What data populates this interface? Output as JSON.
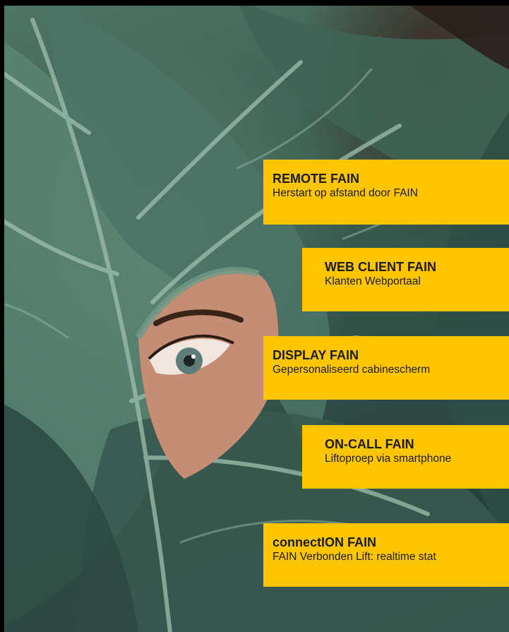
{
  "cards": [
    {
      "title": "REMOTE FAIN",
      "subtitle": "Herstart op afstand door FAIN"
    },
    {
      "title": "WEB CLIENT FAIN",
      "subtitle": "Klanten Webportaal"
    },
    {
      "title": "DISPLAY FAIN",
      "subtitle": "Gepersonaliseerd cabinescherm"
    },
    {
      "title": "ON-CALL FAIN",
      "subtitle": "Liftoproep via smartphone"
    },
    {
      "title": "connectION FAIN",
      "subtitle": "FAIN Verbonden Lift: realtime stat"
    }
  ],
  "colors": {
    "card_background": "#ffc600",
    "leaf_green": "#4e7465"
  }
}
